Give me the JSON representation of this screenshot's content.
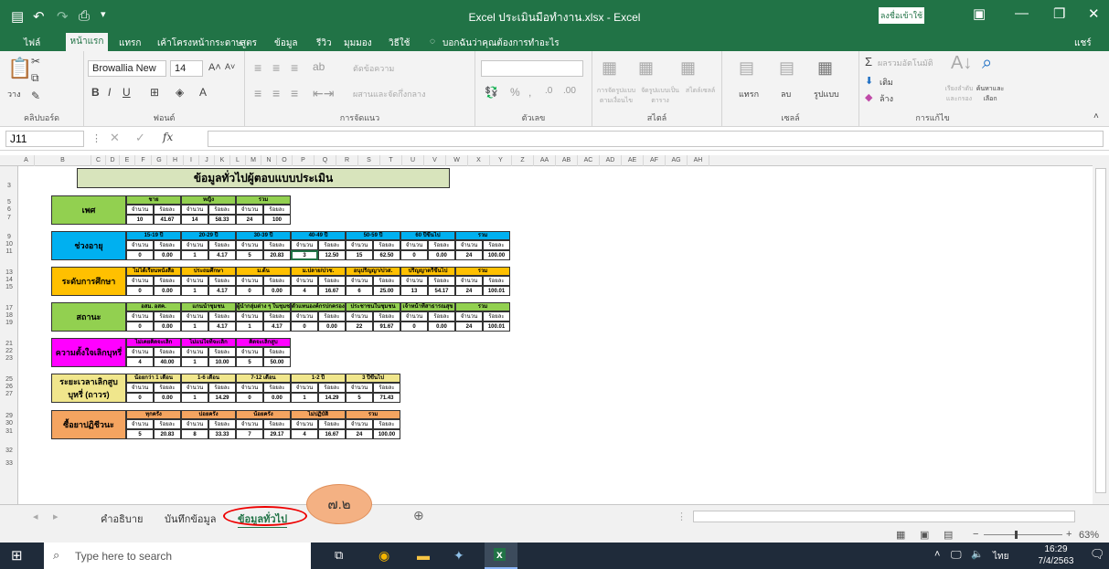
{
  "window": {
    "title": "Excel ประเมินมือทำงาน.xlsx  -  Excel",
    "signin": "ลงชื่อเข้าใช้"
  },
  "ribbon_tabs": [
    "ไฟล์",
    "หน้าแรก",
    "แทรก",
    "เค้าโครงหน้ากระดาษ",
    "สูตร",
    "ข้อมูล",
    "รีวิว",
    "มุมมอง",
    "วิธีใช้"
  ],
  "tell_me": "บอกฉันว่าคุณต้องการทำอะไร",
  "share": "แชร์",
  "ribbon": {
    "clipboard": {
      "label": "คลิปบอร์ด",
      "paste": "วาง"
    },
    "font": {
      "label": "ฟอนต์",
      "name": "Browallia New",
      "size": "14"
    },
    "alignment": {
      "label": "การจัดแนว",
      "wrap": "ตัดข้อความ",
      "merge": "ผสานและจัดกึ่งกลาง"
    },
    "number": {
      "label": "ตัวเลข"
    },
    "styles": {
      "label": "สไตล์",
      "cond": "การจัดรูปแบบตามเงื่อนไข",
      "table": "จัดรูปแบบเป็นตาราง",
      "cell": "สไตล์เซลล์"
    },
    "cells": {
      "label": "เซลล์",
      "insert": "แทรก",
      "delete": "ลบ",
      "format": "รูปแบบ"
    },
    "editing": {
      "label": "การแก้ไข",
      "autosum": "ผลรวมอัตโนมัติ",
      "fill": "เติม",
      "clear": "ล้าง",
      "sort": "เรียงลำดับและกรอง",
      "find": "ค้นหาและเลือก"
    }
  },
  "namebox": "J11",
  "fx": "fx",
  "columns": [
    "A",
    "B",
    "C",
    "D",
    "E",
    "F",
    "G",
    "H",
    "I",
    "J",
    "K",
    "L",
    "M",
    "N",
    "O",
    "P",
    "Q",
    "R",
    "S",
    "T",
    "U",
    "V",
    "W",
    "X",
    "Y",
    "Z",
    "AA",
    "AB",
    "AC",
    "AD",
    "AE",
    "AF",
    "AG",
    "AH"
  ],
  "rows": [
    "3",
    "5",
    "6",
    "7",
    "9",
    "10",
    "11",
    "13",
    "14",
    "15",
    "17",
    "18",
    "19",
    "21",
    "22",
    "23",
    "25",
    "26",
    "27",
    "29",
    "30",
    "31",
    "32",
    "33"
  ],
  "sheet": {
    "title": "ข้อมูลทั่วไปผู้ตอบแบบประเมิน",
    "sections": [
      {
        "label": "เพศ",
        "color": "#92d050",
        "headers": [
          "ชาย",
          "หญิง",
          "รวม"
        ],
        "sub": [
          "จำนวน",
          "ร้อยละ",
          "จำนวน",
          "ร้อยละ",
          "จำนวน",
          "ร้อยละ"
        ],
        "vals": [
          "10",
          "41.67",
          "14",
          "58.33",
          "24",
          "100"
        ]
      },
      {
        "label": "ช่วงอายุ",
        "color": "#00b0f0",
        "headers": [
          "15-19 ปี",
          "20-29 ปี",
          "30-39 ปี",
          "40-49 ปี",
          "50-59 ปี",
          "60 ปีขึ้นไป",
          "รวม"
        ],
        "sub": [
          "จำนวน",
          "ร้อยละ",
          "จำนวน",
          "ร้อยละ",
          "จำนวน",
          "ร้อยละ",
          "จำนวน",
          "ร้อยละ",
          "จำนวน",
          "ร้อยละ",
          "จำนวน",
          "ร้อยละ",
          "จำนวน",
          "ร้อยละ"
        ],
        "vals": [
          "0",
          "0.00",
          "1",
          "4.17",
          "5",
          "20.83",
          "3",
          "12.50",
          "15",
          "62.50",
          "0",
          "0.00",
          "24",
          "100.00"
        ]
      },
      {
        "label": "ระดับการศึกษา",
        "color": "#ffc000",
        "headers": [
          "ไม่ได้เรียนหนังสือ",
          "ประถมศึกษา",
          "ม.ต้น",
          "ม.ปลาย/ปวช.",
          "อนุปริญญา/ปวส.",
          "ปริญญาตรีขึ้นไป",
          "รวม"
        ],
        "sub": [
          "จำนวน",
          "ร้อยละ",
          "จำนวน",
          "ร้อยละ",
          "จำนวน",
          "ร้อยละ",
          "จำนวน",
          "ร้อยละ",
          "จำนวน",
          "ร้อยละ",
          "จำนวน",
          "ร้อยละ",
          "จำนวน",
          "ร้อยละ"
        ],
        "vals": [
          "0",
          "0.00",
          "1",
          "4.17",
          "0",
          "0.00",
          "4",
          "16.67",
          "6",
          "25.00",
          "13",
          "54.17",
          "24",
          "100.01"
        ]
      },
      {
        "label": "สถานะ",
        "color": "#92d050",
        "headers": [
          "อสม. อสค.",
          "แกนนำชุมชน",
          "ผู้นำกลุ่มต่าง ๆ ในชุมชน",
          "ตัวแทนองค์กรปกครองส่วนท้องถิ่น",
          "ประชาชนในชุมชน",
          "เจ้าหน้าที่สาธารณสุข",
          "รวม"
        ],
        "sub": [
          "จำนวน",
          "ร้อยละ",
          "จำนวน",
          "ร้อยละ",
          "จำนวน",
          "ร้อยละ",
          "จำนวน",
          "ร้อยละ",
          "จำนวน",
          "ร้อยละ",
          "จำนวน",
          "ร้อยละ",
          "จำนวน",
          "ร้อยละ"
        ],
        "vals": [
          "0",
          "0.00",
          "1",
          "4.17",
          "1",
          "4.17",
          "0",
          "0.00",
          "22",
          "91.67",
          "0",
          "0.00",
          "24",
          "100.01"
        ]
      },
      {
        "label": "ความตั้งใจเลิกบุหรี่",
        "color": "#ff00ff",
        "headers": [
          "ไม่เคยคิดจะเลิก",
          "ไม่แน่ใจที่จะเลิก",
          "คิดจะเลิกสูบ"
        ],
        "sub": [
          "จำนวน",
          "ร้อยละ",
          "จำนวน",
          "ร้อยละ",
          "จำนวน",
          "ร้อยละ"
        ],
        "vals": [
          "4",
          "40.00",
          "1",
          "10.00",
          "5",
          "50.00"
        ]
      },
      {
        "label": "ระยะเวลาเลิกสูบบุหรี่ (ถาวร)",
        "color": "#f0e68c",
        "headers": [
          "น้อยกว่า 1 เดือน",
          "1-6 เดือน",
          "7-12 เดือน",
          "1-2 ปี",
          "3 ปีขึ้นไป"
        ],
        "sub": [
          "จำนวน",
          "ร้อยละ",
          "จำนวน",
          "ร้อยละ",
          "จำนวน",
          "ร้อยละ",
          "จำนวน",
          "ร้อยละ",
          "จำนวน",
          "ร้อยละ"
        ],
        "vals": [
          "0",
          "0.00",
          "1",
          "14.29",
          "0",
          "0.00",
          "1",
          "14.29",
          "5",
          "71.43"
        ]
      },
      {
        "label": "ซื้อยาปฏิชีวนะ",
        "color": "#f4a460",
        "headers": [
          "ทุกครั้ง",
          "บ่อยครั้ง",
          "น้อยครั้ง",
          "ไม่ปฏิบัติ",
          "รวม"
        ],
        "sub": [
          "จำนวน",
          "ร้อยละ",
          "จำนวน",
          "ร้อยละ",
          "จำนวน",
          "ร้อยละ",
          "จำนวน",
          "ร้อยละ",
          "จำนวน",
          "ร้อยละ"
        ],
        "vals": [
          "5",
          "20.83",
          "8",
          "33.33",
          "7",
          "29.17",
          "4",
          "16.67",
          "24",
          "100.00"
        ]
      }
    ]
  },
  "sheet_tabs": [
    "คำอธิบาย",
    "บันทึกข้อมูล",
    "ข้อมูลทั่วไป"
  ],
  "callout": "๗.๒",
  "zoom": "63%",
  "taskbar": {
    "search": "Type here to search",
    "time": "16:29",
    "date": "7/4/2563",
    "lang": "ไทย"
  }
}
